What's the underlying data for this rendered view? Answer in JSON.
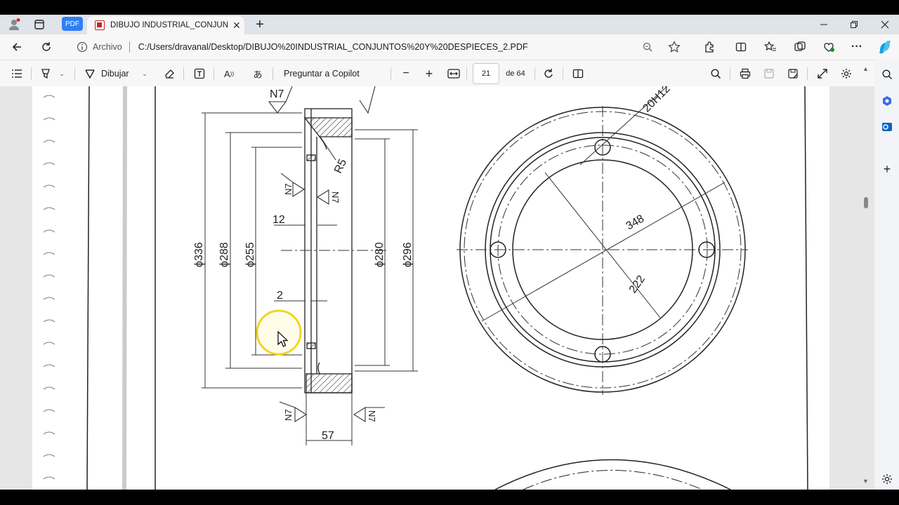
{
  "tab": {
    "title": "DIBUJO INDUSTRIAL_CONJUNTOS"
  },
  "pdf_chip": "PDF",
  "address": {
    "label": "Archivo",
    "url": "C:/Users/dravanal/Desktop/DIBUJO%20INDUSTRIAL_CONJUNTOS%20Y%20DESPIECES_2.PDF"
  },
  "pdf_toolbar": {
    "draw_label": "Dibujar",
    "copilot_label": "Preguntar a Copilot",
    "page_current": "21",
    "page_total": "de 64"
  },
  "drawing": {
    "labels": {
      "n7": "N7",
      "r5": "R5",
      "d336": "ϕ336",
      "d288": "ϕ288",
      "d255": "ϕ255",
      "d280": "ϕ280",
      "d296": "ϕ296",
      "dim12": "12",
      "dim2": "2",
      "dim57": "57",
      "dim348": "348",
      "dim222": "222",
      "hole": "20H12"
    }
  }
}
